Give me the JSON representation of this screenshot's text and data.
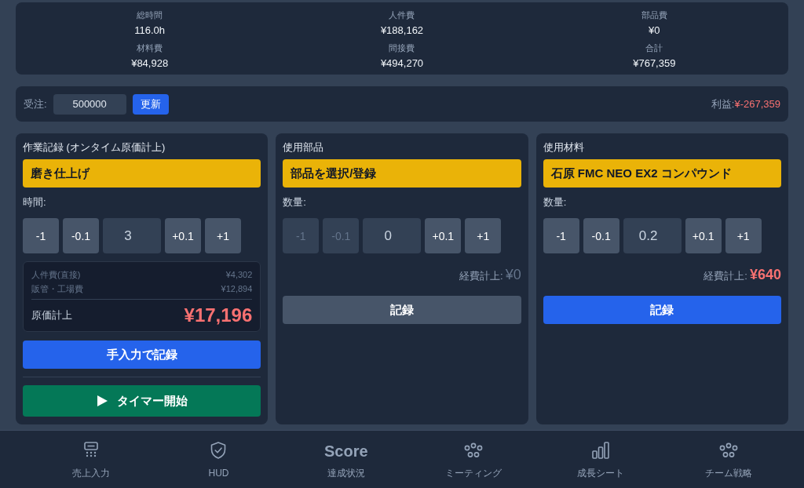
{
  "summary": [
    {
      "label": "総時間",
      "value": "116.0h"
    },
    {
      "label": "人件費",
      "value": "¥188,162"
    },
    {
      "label": "部品費",
      "value": "¥0"
    },
    {
      "label": "材料費",
      "value": "¥84,928"
    },
    {
      "label": "間接費",
      "value": "¥494,270"
    },
    {
      "label": "合計",
      "value": "¥767,359"
    }
  ],
  "order": {
    "label": "受注:",
    "value": "500000",
    "button": "更新",
    "profit_label": "利益:",
    "profit_value": "¥-267,359"
  },
  "panels": [
    {
      "kind": "work",
      "title": "作業記録 (オンタイム原価計上)",
      "selector": "磨き仕上げ",
      "quantity_label": "時間:",
      "decrements": [
        {
          "label": "-1",
          "disabled": false
        },
        {
          "label": "-0.1",
          "disabled": false
        }
      ],
      "value": "3",
      "increments": [
        {
          "label": "+0.1",
          "disabled": false
        },
        {
          "label": "+1",
          "disabled": false
        }
      ],
      "breakdown": {
        "rows": [
          {
            "label": "人件費(直接)",
            "value": "¥4,302"
          },
          {
            "label": "販管・工場費",
            "value": "¥12,894"
          }
        ],
        "total_label": "原価計上",
        "total_value": "¥17,196"
      },
      "actions": [
        {
          "kind": "manual",
          "label": "手入力で記録"
        },
        {
          "kind": "timer",
          "label": "タイマー開始"
        }
      ]
    },
    {
      "kind": "usage",
      "title": "使用部品",
      "selector": "部品を選択/登録",
      "quantity_label": "数量:",
      "decrements": [
        {
          "label": "-1",
          "disabled": true
        },
        {
          "label": "-0.1",
          "disabled": true
        }
      ],
      "value": "0",
      "increments": [
        {
          "label": "+0.1",
          "disabled": false
        },
        {
          "label": "+1",
          "disabled": false
        }
      ],
      "expense": {
        "label": "経費計上:",
        "value": "¥0",
        "highlighted": false
      },
      "record_button": {
        "label": "記録",
        "disabled": true
      }
    },
    {
      "kind": "usage",
      "title": "使用材料",
      "selector": "石原 FMC NEO EX2 コンパウンド",
      "quantity_label": "数量:",
      "decrements": [
        {
          "label": "-1",
          "disabled": false
        },
        {
          "label": "-0.1",
          "disabled": false
        }
      ],
      "value": "0.2",
      "increments": [
        {
          "label": "+0.1",
          "disabled": false
        },
        {
          "label": "+1",
          "disabled": false
        }
      ],
      "expense": {
        "label": "経費計上:",
        "value": "¥640",
        "highlighted": true
      },
      "record_button": {
        "label": "記録",
        "disabled": false
      }
    }
  ],
  "nav": [
    {
      "kind": "icon",
      "label": "売上入力"
    },
    {
      "kind": "icon",
      "label": "HUD"
    },
    {
      "kind": "text",
      "glyph": "Score",
      "label": "達成状況"
    },
    {
      "kind": "icon",
      "label": "ミーティング"
    },
    {
      "kind": "icon",
      "label": "成長シート"
    },
    {
      "kind": "icon",
      "label": "チーム戦略"
    }
  ]
}
